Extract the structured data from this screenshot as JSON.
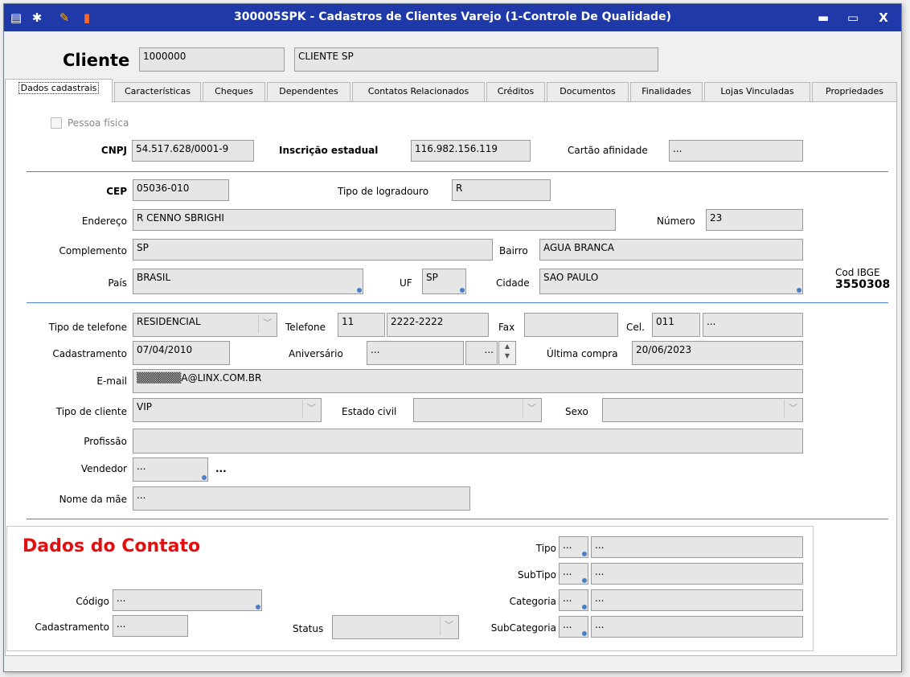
{
  "window": {
    "title": "300005SPK - Cadastros de Clientes Varejo (1-Controle De Qualidade)",
    "buttons": {
      "minimize": "▬",
      "maximize": "▭",
      "close": "X"
    }
  },
  "header": {
    "label": "Cliente",
    "code": "1000000",
    "name": "CLIENTE SP"
  },
  "tabs": [
    "Dados cadastrais",
    "Características",
    "Cheques",
    "Dependentes",
    "Contatos Relacionados",
    "Créditos",
    "Documentos",
    "Finalidades",
    "Lojas Vinculadas",
    "Propriedades"
  ],
  "dados": {
    "pessoa_fisica": "Pessoa física",
    "cnpj_label": "CNPJ",
    "cnpj": "54.517.628/0001-9",
    "ie_label": "Inscrição estadual",
    "ie": "116.982.156.119",
    "cartao_label": "Cartão afinidade",
    "cartao": "...",
    "cep_label": "CEP",
    "cep": "05036-010",
    "tipo_logradouro_label": "Tipo de logradouro",
    "tipo_logradouro": "R",
    "endereco_label": "Endereço",
    "endereco": "R CENNO SBRIGHI",
    "numero_label": "Número",
    "numero": "23",
    "complemento_label": "Complemento",
    "complemento": "SP",
    "bairro_label": "Bairro",
    "bairro": "AGUA BRANCA",
    "pais_label": "País",
    "pais": "BRASIL",
    "uf_label": "UF",
    "uf": "SP",
    "cidade_label": "Cidade",
    "cidade": "SAO PAULO",
    "ibge_label": "Cod IBGE",
    "ibge": "3550308",
    "tipo_telefone_label": "Tipo de telefone",
    "tipo_telefone": "RESIDENCIAL",
    "telefone_label": "Telefone",
    "ddd": "11",
    "telefone": "2222-2222",
    "fax_label": "Fax",
    "fax": "",
    "cel_label": "Cel.",
    "cel_ddd": "011",
    "cel": "...",
    "cadastramento_label": "Cadastramento",
    "cadastramento": "07/04/2010",
    "aniversario_label": "Aniversário",
    "aniversario": "...",
    "aniversario_ano": "...",
    "ultima_compra_label": "Última compra",
    "ultima_compra": "20/06/2023",
    "email_label": "E-mail",
    "email": "▒▒▒▒▒▒A@LINX.COM.BR",
    "tipo_cliente_label": "Tipo de cliente",
    "tipo_cliente": "VIP",
    "estado_civil_label": "Estado civil",
    "estado_civil": "",
    "sexo_label": "Sexo",
    "sexo": "",
    "profissao_label": "Profissão",
    "profissao": "",
    "vendedor_label": "Vendedor",
    "vendedor": "...",
    "vendedor_nome": "...",
    "nome_mae_label": "Nome da mãe",
    "nome_mae": "..."
  },
  "contato": {
    "title": "Dados do Contato",
    "codigo_label": "Código",
    "codigo": "...",
    "cadastramento_label": "Cadastramento",
    "cadastramento": "...",
    "status_label": "Status",
    "status": "",
    "tipo_label": "Tipo",
    "tipo_code": "...",
    "tipo": "...",
    "subtipo_label": "SubTipo",
    "subtipo_code": "...",
    "subtipo": "...",
    "categoria_label": "Categoria",
    "categoria_code": "...",
    "categoria": "...",
    "subcategoria_label": "SubCategoria",
    "subcategoria_code": "...",
    "subcategoria": "..."
  },
  "colors": {
    "titlebar": "#1f3aa8",
    "separator": "#4a86c8",
    "contact_title": "#e01010"
  }
}
